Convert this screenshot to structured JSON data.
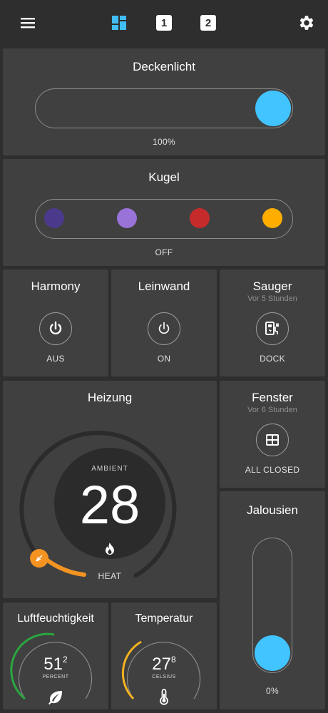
{
  "topbar": {
    "icons": [
      "menu-icon",
      "dashboard-icon",
      "view-1-icon",
      "view-2-icon",
      "settings-icon"
    ],
    "view1_label": "1",
    "view2_label": "2",
    "active_color": "#41bdf5"
  },
  "deckenlicht": {
    "title": "Deckenlicht",
    "value_label": "100%",
    "level": 1.0,
    "knob_color": "#41c4ff"
  },
  "kugel": {
    "title": "Kugel",
    "state": "OFF",
    "colors": [
      "#4b3a8c",
      "#9a73d9",
      "#c62b2b",
      "#ffae00"
    ]
  },
  "harmony": {
    "title": "Harmony",
    "state": "AUS"
  },
  "leinwand": {
    "title": "Leinwand",
    "state": "ON"
  },
  "sauger": {
    "title": "Sauger",
    "subtitle": "Vor 5 Stunden",
    "state": "DOCK"
  },
  "heizung": {
    "title": "Heizung",
    "ambient_label": "AMBIENT",
    "temperature": "28",
    "mode": "HEAT",
    "accent": "#f39322"
  },
  "fenster": {
    "title": "Fenster",
    "subtitle": "Vor 6 Stunden",
    "state": "ALL CLOSED"
  },
  "jalousien": {
    "title": "Jalousien",
    "value_label": "0%",
    "level": 0.0,
    "knob_color": "#41c4ff"
  },
  "luftfeuchtigkeit": {
    "title": "Luftfeuchtigkeit",
    "value_main": "51",
    "value_decimal": "2",
    "unit": "PERCENT",
    "arc_color": "#2aa640"
  },
  "temperatur": {
    "title": "Temperatur",
    "value_main": "27",
    "value_decimal": "8",
    "unit": "CELSIUS",
    "arc_color": "#f2b21f"
  }
}
